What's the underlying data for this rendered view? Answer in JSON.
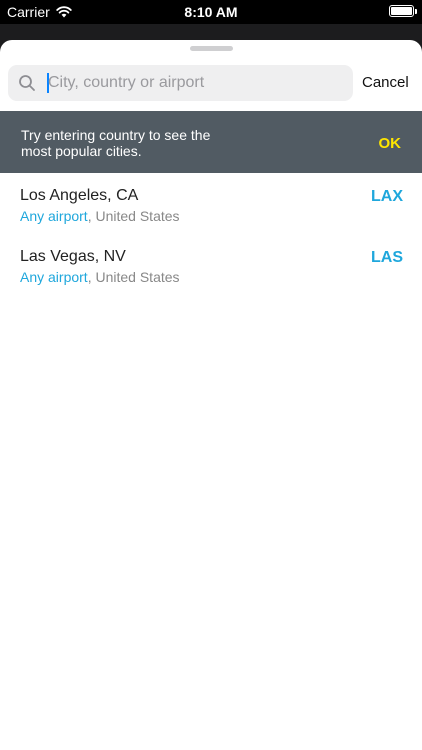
{
  "status_bar": {
    "carrier": "Carrier",
    "time": "8:10 AM",
    "icons": [
      "wifi-icon",
      "battery-icon"
    ]
  },
  "search": {
    "placeholder": "City, country or airport",
    "value": "",
    "icon": "search-icon",
    "cancel_label": "Cancel"
  },
  "banner": {
    "message": "Try entering country to see the most popular cities.",
    "ok_label": "OK"
  },
  "results": [
    {
      "city": "Los Angeles, CA",
      "any_airport": "Any airport",
      "separator": ", ",
      "country": "United States",
      "code": "LAX"
    },
    {
      "city": "Las Vegas, NV",
      "any_airport": "Any airport",
      "separator": ", ",
      "country": "United States",
      "code": "LAS"
    }
  ],
  "colors": {
    "accent": "#1fa7dc",
    "banner_bg": "#515b63",
    "banner_ok": "#ffe600"
  }
}
